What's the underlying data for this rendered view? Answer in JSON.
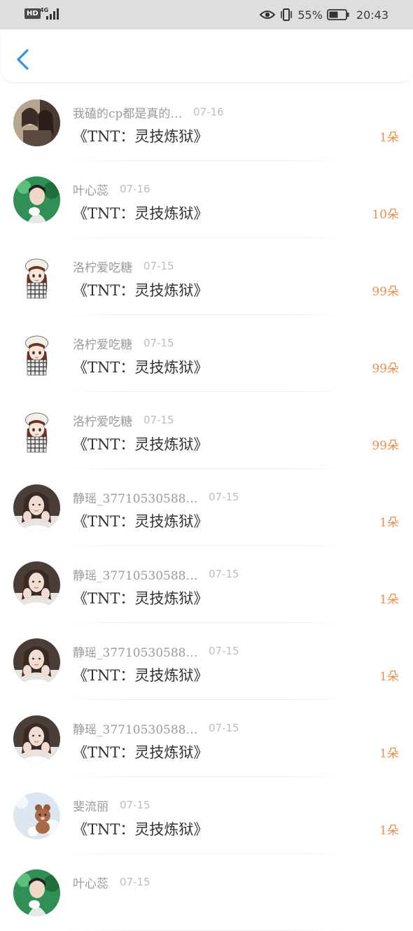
{
  "status_bar": {
    "hd": "HD",
    "network": "4G",
    "battery_percent": "55%",
    "time": "20:43"
  },
  "colors": {
    "accent": "#2f96e6",
    "count": "#e8904d"
  },
  "items": [
    {
      "name": "我磕的cp都是真的…",
      "date": "07-16",
      "title": "《TNT：灵技炼狱》",
      "count": "1朵",
      "avatar": "cp"
    },
    {
      "name": "叶心蕊",
      "date": "07-16",
      "title": "《TNT：灵技炼狱》",
      "count": "10朵",
      "avatar": "boy"
    },
    {
      "name": "洛柠爱吃糖",
      "date": "07-15",
      "title": "《TNT：灵技炼狱》",
      "count": "99朵",
      "avatar": "cartoon"
    },
    {
      "name": "洛柠爱吃糖",
      "date": "07-15",
      "title": "《TNT：灵技炼狱》",
      "count": "99朵",
      "avatar": "cartoon"
    },
    {
      "name": "洛柠爱吃糖",
      "date": "07-15",
      "title": "《TNT：灵技炼狱》",
      "count": "99朵",
      "avatar": "cartoon"
    },
    {
      "name": "静瑶_37710530588…",
      "date": "07-15",
      "title": "《TNT：灵技炼狱》",
      "count": "1朵",
      "avatar": "girl"
    },
    {
      "name": "静瑶_37710530588…",
      "date": "07-15",
      "title": "《TNT：灵技炼狱》",
      "count": "1朵",
      "avatar": "girl"
    },
    {
      "name": "静瑶_37710530588…",
      "date": "07-15",
      "title": "《TNT：灵技炼狱》",
      "count": "1朵",
      "avatar": "girl"
    },
    {
      "name": "静瑶_37710530588…",
      "date": "07-15",
      "title": "《TNT：灵技炼狱》",
      "count": "1朵",
      "avatar": "girl"
    },
    {
      "name": "斐流丽",
      "date": "07-15",
      "title": "《TNT：灵技炼狱》",
      "count": "1朵",
      "avatar": "bear"
    },
    {
      "name": "叶心蕊",
      "date": "07-15",
      "title": "",
      "count": "",
      "avatar": "boy"
    }
  ]
}
